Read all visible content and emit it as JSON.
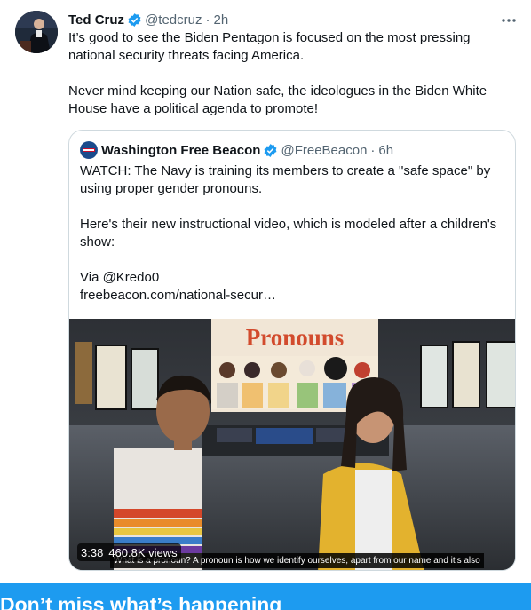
{
  "tweet": {
    "author_name": "Ted Cruz",
    "author_handle": "@tedcruz",
    "separator": "·",
    "time": "2h",
    "paragraphs": [
      "It’s good to see the Biden Pentagon is focused on the most pressing national security threats facing America.",
      "Never mind keeping our Nation safe, the ideologues in the Biden White House have a political agenda to promote!"
    ]
  },
  "quoted": {
    "author_name": "Washington Free Beacon",
    "author_handle": "@FreeBeacon",
    "separator": "·",
    "time": "6h",
    "paragraphs": [
      "WATCH: The Navy is training its members to create a \"safe space\" by using proper gender pronouns.",
      "Here's their new instructional video, which is modeled after a children's show:",
      "Via @Kredo0\nfreebeacon.com/national-secur…"
    ],
    "video": {
      "duration": "3:38",
      "views": "460.8K views",
      "sign_text": "Pronouns",
      "caption": "What is a pronoun? A pronoun is how we identify ourselves, apart from our name and it's also"
    }
  },
  "banner": {
    "title": "Don’t miss what’s happening"
  },
  "colors": {
    "accent": "#1d9bf0",
    "text": "#0f1419",
    "secondary": "#536471",
    "border": "#cfd9de"
  }
}
